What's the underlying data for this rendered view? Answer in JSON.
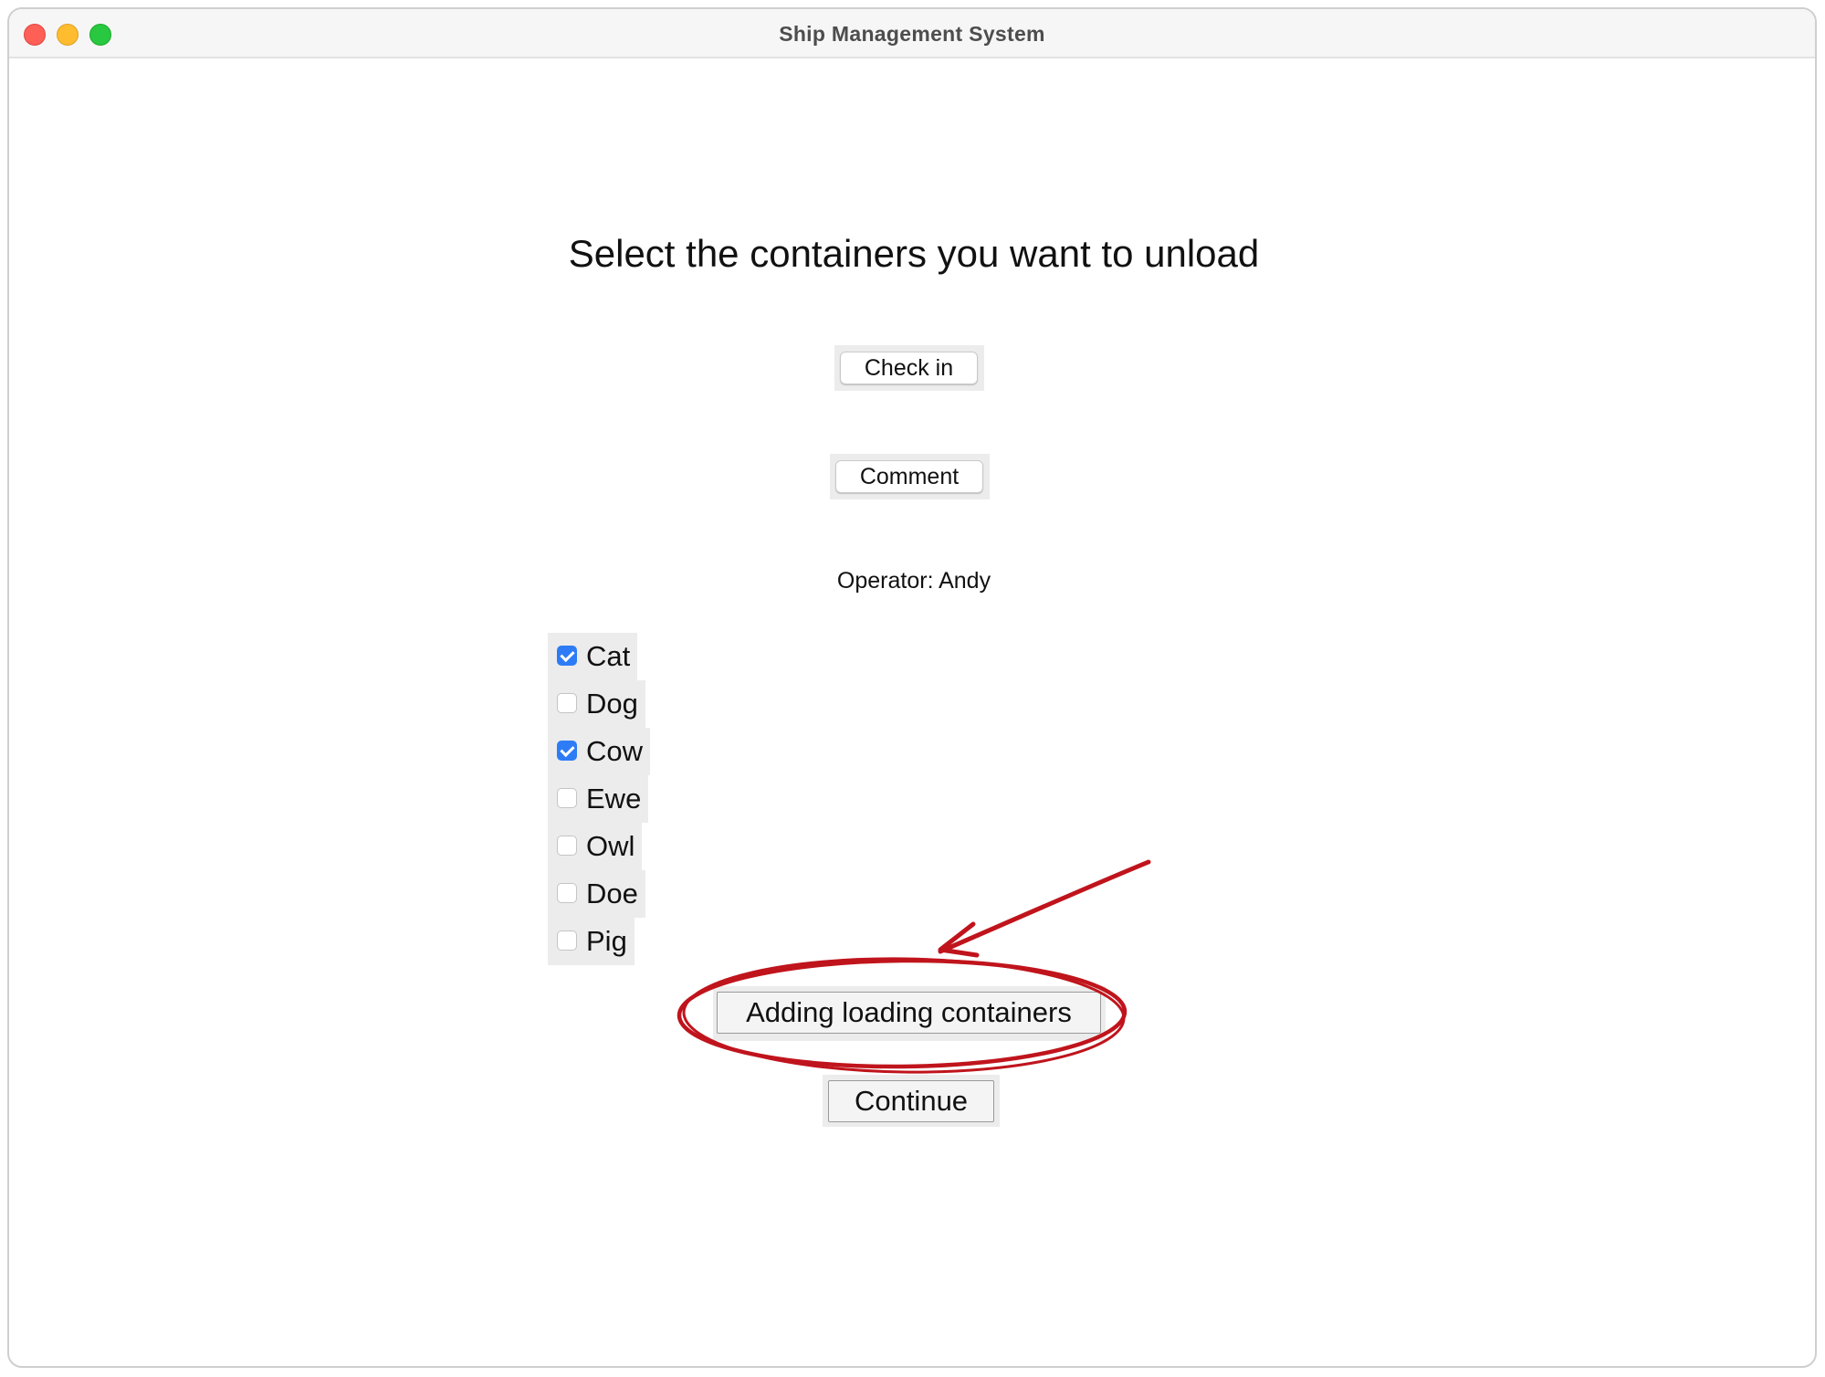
{
  "window": {
    "title": "Ship Management System"
  },
  "main": {
    "heading": "Select the containers you want to unload",
    "check_in_label": "Check in",
    "comment_label": "Comment",
    "operator_text": "Operator: Andy",
    "containers": [
      {
        "label": "Cat",
        "checked": true
      },
      {
        "label": "Dog",
        "checked": false
      },
      {
        "label": "Cow",
        "checked": true
      },
      {
        "label": "Ewe",
        "checked": false
      },
      {
        "label": "Owl",
        "checked": false
      },
      {
        "label": "Doe",
        "checked": false
      },
      {
        "label": "Pig",
        "checked": false
      }
    ],
    "add_loading_label": "Adding loading containers",
    "continue_label": "Continue"
  },
  "colors": {
    "checkbox_checked": "#2d7cf6",
    "annotation_red": "#c0141c"
  }
}
